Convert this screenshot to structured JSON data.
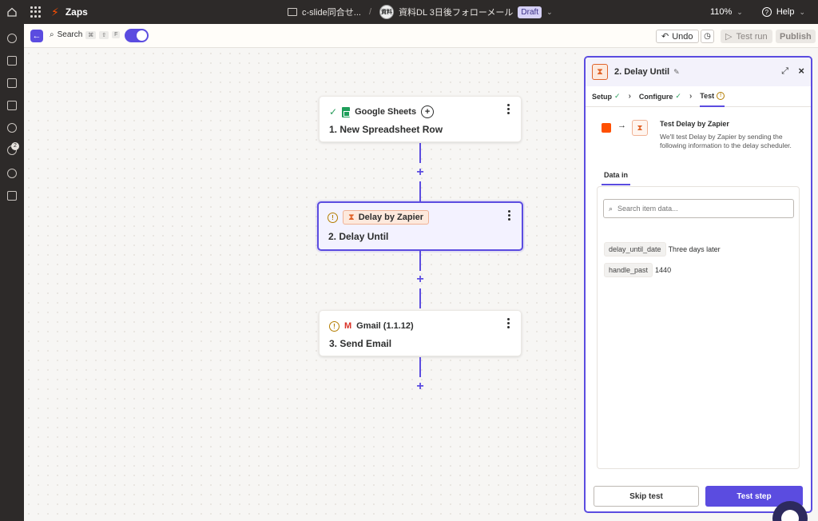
{
  "topbar": {
    "app_name": "Zaps",
    "folder": "c-slide同合せ...",
    "avatar_text": "資料",
    "zap_title": "資料DL 3日後フォローメール",
    "status": "Draft",
    "zoom": "110%",
    "help": "Help"
  },
  "rail": {
    "notification_count": "2"
  },
  "toolbar": {
    "search_label": "Search",
    "shortcut_keys": [
      "⌘",
      "⇧",
      "F"
    ],
    "undo_label": "Undo",
    "test_run_label": "Test run",
    "publish_label": "Publish"
  },
  "steps": [
    {
      "app": "Google Sheets",
      "title": "1. New Spreadsheet Row",
      "status": "ok"
    },
    {
      "app": "Delay by Zapier",
      "title": "2. Delay Until",
      "status": "warning"
    },
    {
      "app": "Gmail (1.1.12)",
      "title": "3. Send Email",
      "status": "warning"
    }
  ],
  "panel": {
    "title": "2. Delay Until",
    "tabs": [
      {
        "label": "Setup"
      },
      {
        "label": "Configure"
      },
      {
        "label": "Test"
      }
    ],
    "test_title": "Test Delay by Zapier",
    "test_desc": "We'll test Delay by Zapier by sending the following information to the delay scheduler.",
    "data_in_tab": "Data in",
    "search_placeholder": "Search item data...",
    "data": [
      {
        "key": "delay_until_date",
        "value": "Three days later"
      },
      {
        "key": "handle_past",
        "value": "1440"
      }
    ],
    "skip_label": "Skip test",
    "test_step_label": "Test step"
  },
  "colors": {
    "accent": "#5b4ce0",
    "brand": "#ff4f00",
    "warning": "#b47d00",
    "success": "#2a9d5c"
  }
}
